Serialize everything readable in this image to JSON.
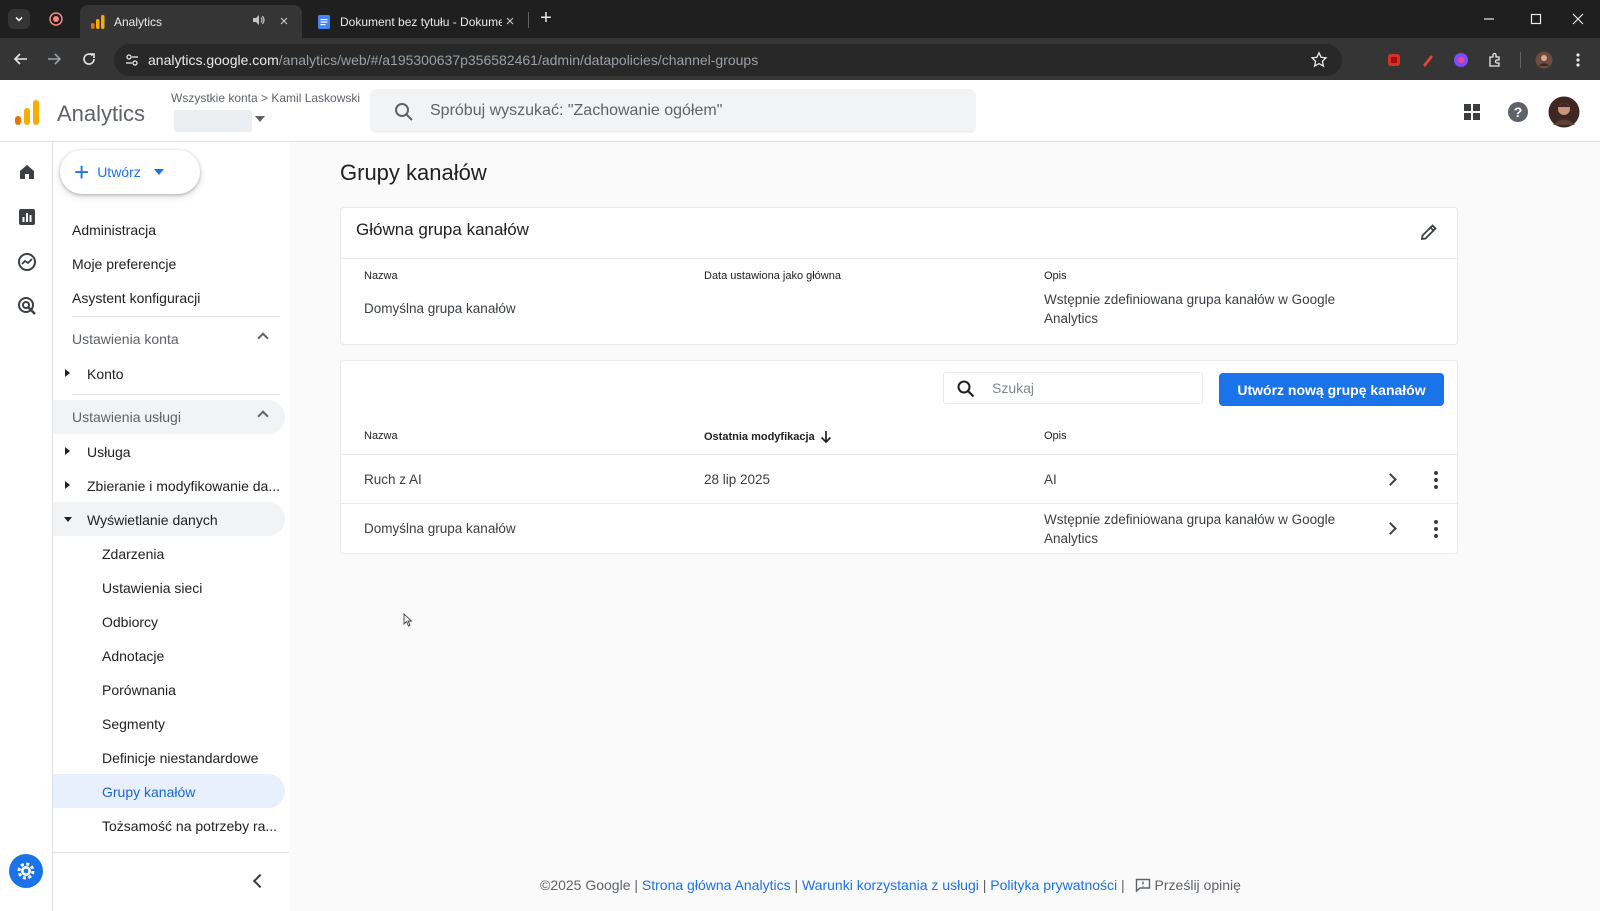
{
  "browser": {
    "tabs": [
      {
        "title": "Analytics",
        "active": true
      },
      {
        "title": "Dokument bez tytułu - Dokume",
        "active": false
      }
    ],
    "new_tab": "+",
    "window_controls": [
      "minimize",
      "maximize",
      "close"
    ],
    "url_domain": "analytics.google.com",
    "url_path": "/analytics/web/#/a195300637p356582461/admin/datapolicies/channel-groups"
  },
  "app": {
    "title": "Analytics",
    "breadcrumb": "Wszystkie konta > Kamil Laskowski",
    "search_placeholder": "Spróbuj wyszukać: \"Zachowanie ogółem\""
  },
  "sidebar": {
    "create_label": "Utwórz",
    "top_items": [
      "Administracja",
      "Moje preferencje",
      "Asystent konfiguracji"
    ],
    "account_section": "Ustawienia konta",
    "account_items": [
      "Konto"
    ],
    "property_section": "Ustawienia usługi",
    "property_items": [
      "Usługa",
      "Zbieranie i modyfikowanie da...",
      "Wyświetlanie danych"
    ],
    "data_display_items": [
      "Zdarzenia",
      "Ustawienia sieci",
      "Odbiorcy",
      "Adnotacje",
      "Porównania",
      "Segmenty",
      "Definicje niestandardowe",
      "Grupy kanałów",
      "Tożsamość na potrzeby ra..."
    ]
  },
  "main": {
    "page_title": "Grupy kanałów",
    "primary_card": {
      "title": "Główna grupa kanałów",
      "col_name": "Nazwa",
      "col_date": "Data ustawiona jako główna",
      "col_desc": "Opis",
      "name": "Domyślna grupa kanałów",
      "date": "",
      "desc": "Wstępnie zdefiniowana grupa kanałów w Google Analytics"
    },
    "table": {
      "search_placeholder": "Szukaj",
      "create_button": "Utwórz nową grupę kanałów",
      "col_name": "Nazwa",
      "col_modified": "Ostatnia modyfikacja",
      "col_desc": "Opis",
      "rows": [
        {
          "name": "Ruch z AI",
          "modified": "28 lip 2025",
          "desc": "AI"
        },
        {
          "name": "Domyślna grupa kanałów",
          "modified": "",
          "desc": "Wstępnie zdefiniowana grupa kanałów w Google Analytics"
        }
      ]
    }
  },
  "footer": {
    "copyright": "©2025 Google |",
    "link1": "Strona główna Analytics",
    "link2": "Warunki korzystania z usługi",
    "link3": "Polityka prywatności",
    "sep": "|",
    "feedback": "Prześlij opinię"
  },
  "colors": {
    "accent": "#1a73e8",
    "analytics_orange": "#f9ab00",
    "analytics_dark_orange": "#e37400"
  }
}
